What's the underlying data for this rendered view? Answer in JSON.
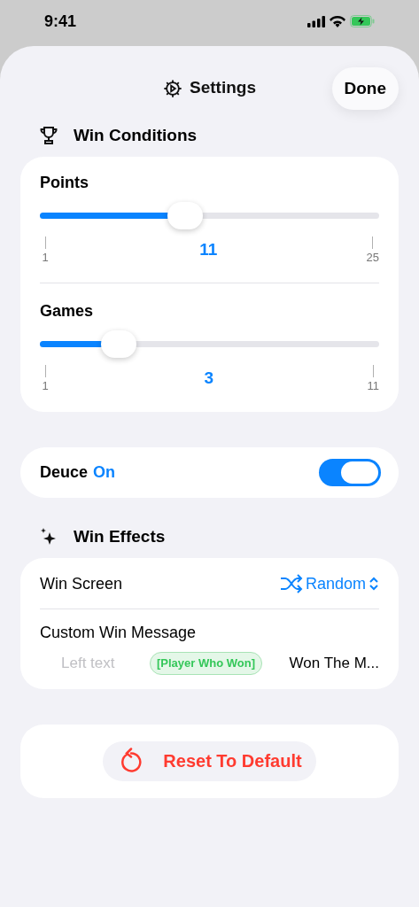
{
  "status_bar": {
    "time": "9:41"
  },
  "header": {
    "title": "Settings",
    "done": "Done"
  },
  "win_conditions": {
    "title": "Win Conditions",
    "sliders": [
      {
        "label": "Points",
        "level": 0.42,
        "min": "1",
        "max": "25",
        "value": "11"
      },
      {
        "label": "Games",
        "level": 0.2,
        "min": "1",
        "max": "11",
        "value": "3"
      }
    ]
  },
  "deuce": {
    "label": "Deuce",
    "state_text": "On",
    "on": true
  },
  "win_effects": {
    "title": "Win Effects",
    "win_screen": {
      "label": "Win Screen",
      "value": "Random"
    },
    "custom_message": {
      "label": "Custom Win Message",
      "left_placeholder": "Left text",
      "tag": "[Player Who Won]",
      "right_value": "Won The M..."
    }
  },
  "reset": {
    "label": "Reset To Default"
  }
}
